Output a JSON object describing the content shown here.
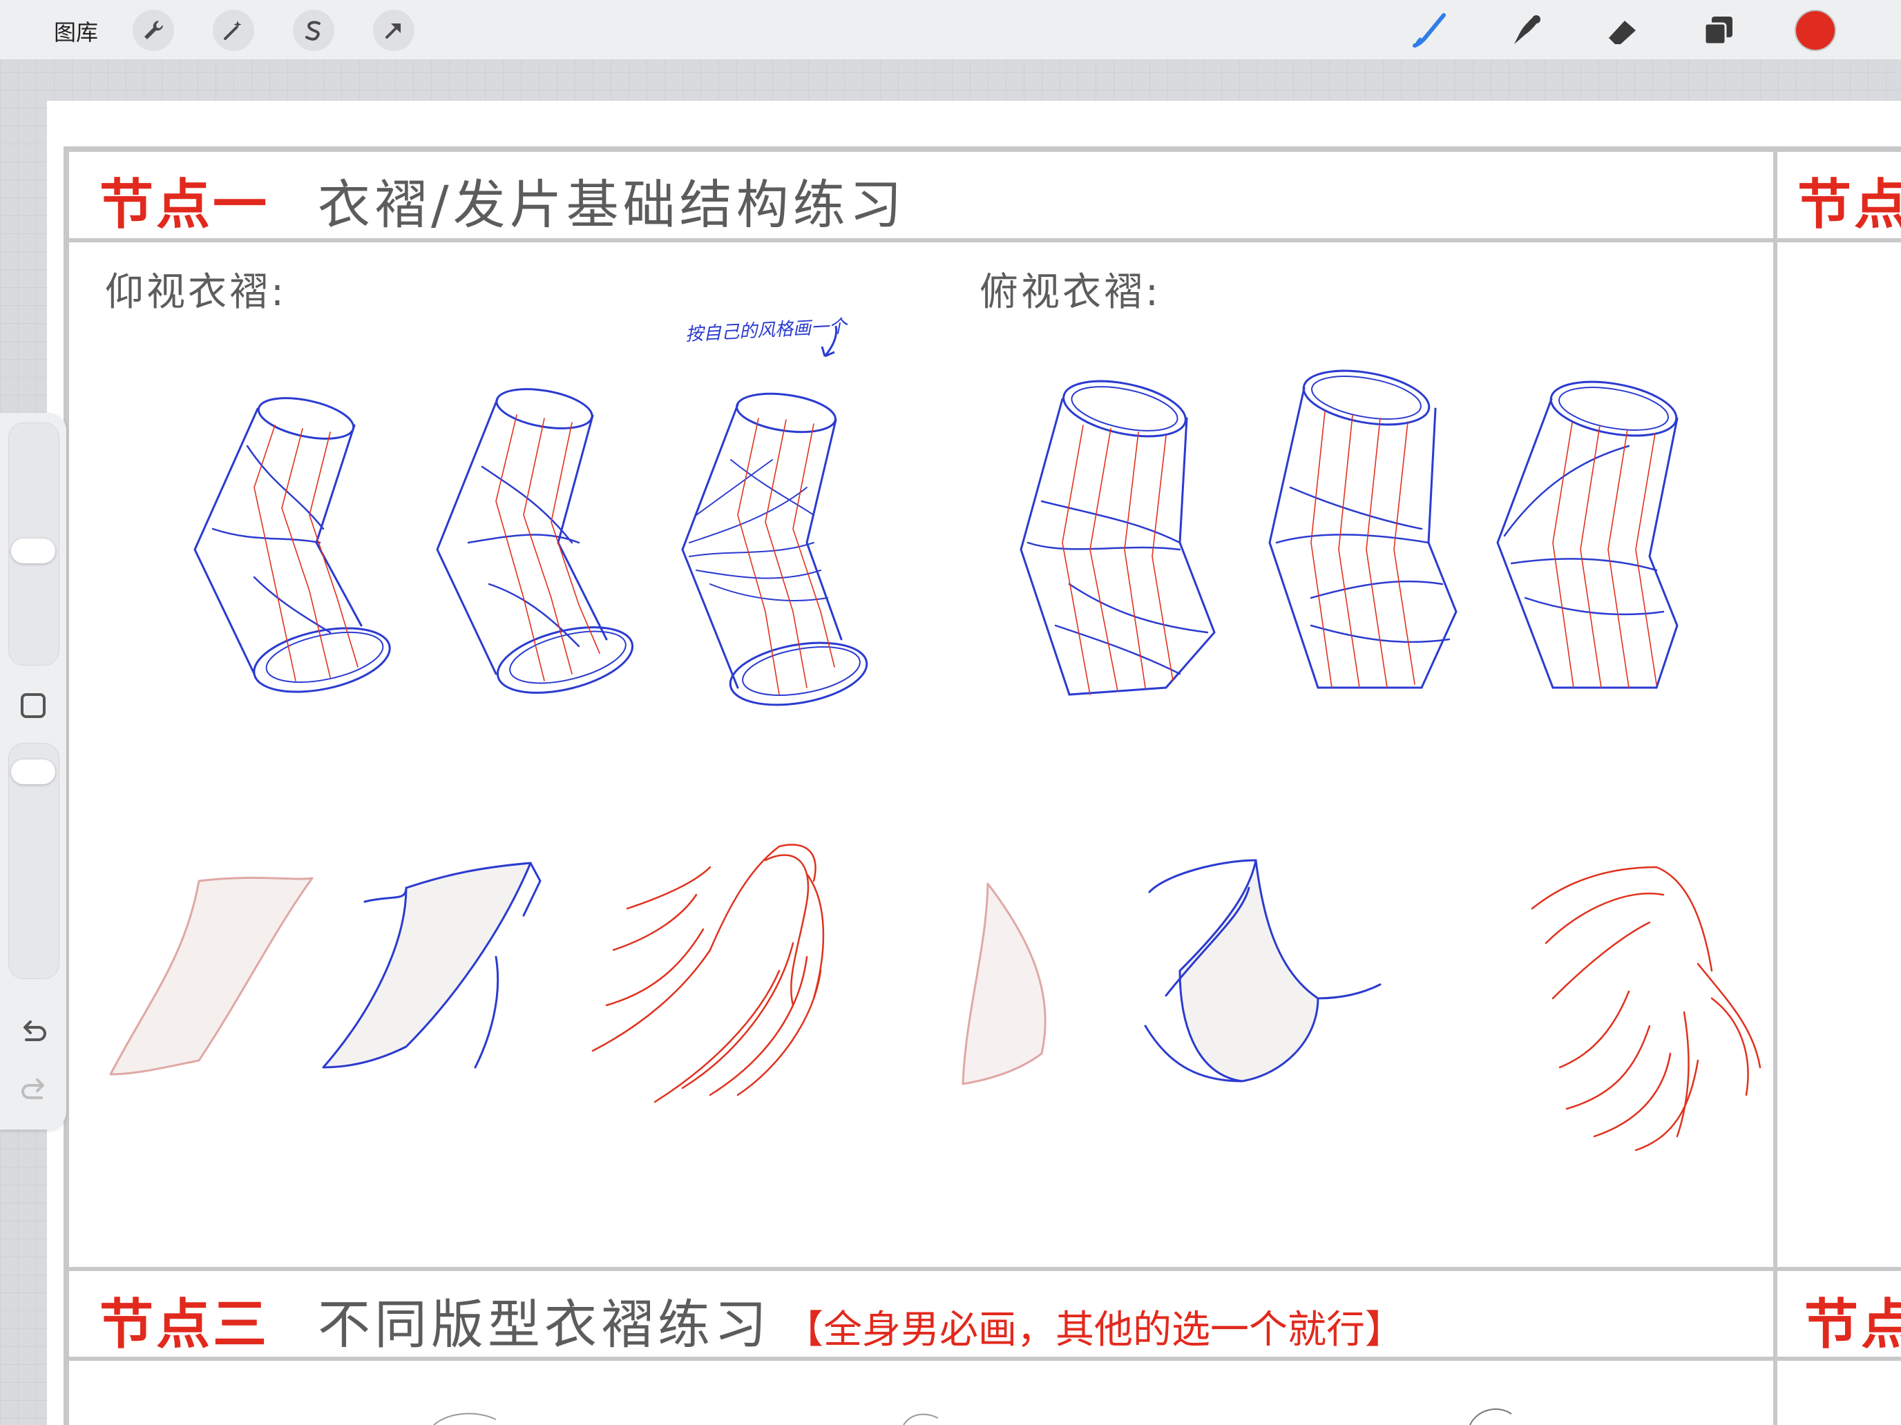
{
  "toolbar": {
    "gallery_label": "图库",
    "left_tools": [
      "wrench-icon",
      "magic-wand-icon",
      "selection-icon",
      "transform-arrow-icon"
    ],
    "right_tools": [
      "brush-icon",
      "smudge-icon",
      "eraser-icon",
      "layers-icon"
    ],
    "current_color": "#e02b20"
  },
  "sections": {
    "s1": {
      "num": "节点一",
      "title": "衣褶/发片基础结构练习"
    },
    "s1_right": {
      "num": "节点"
    },
    "s3": {
      "num": "节点三",
      "title": "不同版型衣褶练习",
      "note": "【全身男必画，其他的选一个就行】"
    },
    "s3_right": {
      "num": "节点"
    }
  },
  "labels": {
    "upward": "仰视衣褶:",
    "downward": "俯视衣褶:",
    "handnote": "按自己的风格画一个"
  },
  "colors": {
    "accent_red": "#e2291d",
    "sketch_blue": "#2b3bd0",
    "sketch_red": "#e0321e"
  }
}
